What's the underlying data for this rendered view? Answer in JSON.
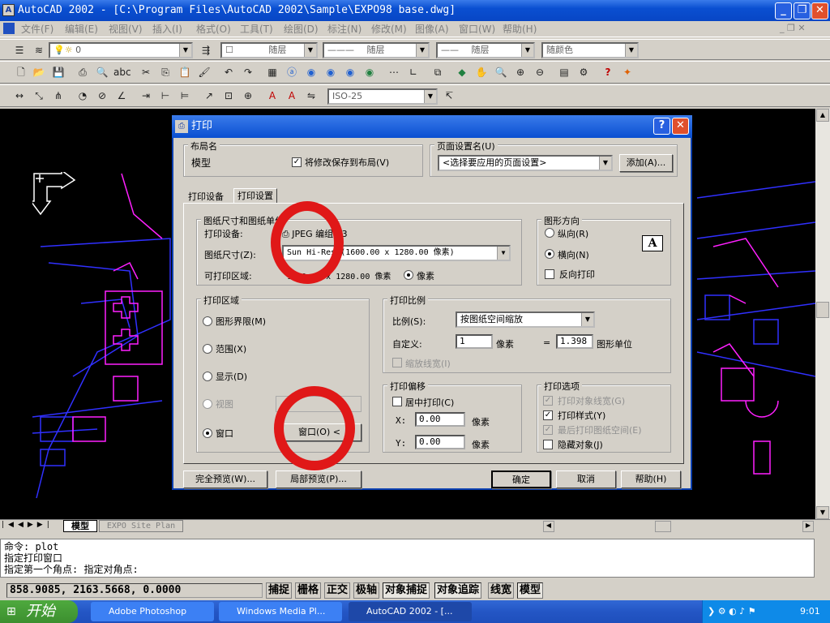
{
  "window": {
    "title": "AutoCAD 2002 - [C:\\Program Files\\AutoCAD 2002\\Sample\\EXPO98 base.dwg]",
    "min": "_",
    "max": "❐",
    "close": "✕"
  },
  "menu": [
    "文件(F)",
    "编辑(E)",
    "视图(V)",
    "插入(I)",
    "格式(O)",
    "工具(T)",
    "绘图(D)",
    "标注(N)",
    "修改(M)",
    "图像(A)",
    "窗口(W)",
    "帮助(H)"
  ],
  "toolbar": {
    "layer_value": "0",
    "color_value": "随层",
    "linetype_value": "随层",
    "lineweight_value": "随层",
    "plotstyle_value": "随颜色",
    "dimstyle_value": "ISO-25"
  },
  "tabs": {
    "model": "模型",
    "layout": "EXPO Site Plan"
  },
  "command": [
    "命令: plot",
    "指定打印窗口",
    "指定第一个角点: 指定对角点:"
  ],
  "status": {
    "coords": "858.9085, 2163.5668, 0.0000",
    "buttons": [
      "捕捉",
      "栅格",
      "正交",
      "极轴",
      "对象捕捉",
      "对象追踪",
      "线宽",
      "模型"
    ]
  },
  "taskbar": {
    "start": "开始",
    "tasks": [
      "Adobe Photoshop",
      "Windows Media Pl...",
      "AutoCAD 2002 - [..."
    ],
    "clock": "9:01"
  },
  "dialog": {
    "title": "打印",
    "help_btn": "?",
    "close_btn": "✕",
    "layout_group": "布局名",
    "layout_name": "模型",
    "save_changes": "将修改保存到布局(V)",
    "page_setup_group": "页面设置名(U)",
    "page_setup_value": "<选择要应用的页面设置>",
    "add_btn": "添加(A)...",
    "tab_device": "打印设备",
    "tab_settings": "打印设置",
    "paper_group": "图纸尺寸和图纸单位",
    "device_label": "打印设备:",
    "device_value": "JPEG 编组...3",
    "paper_size_label": "图纸尺寸(Z):",
    "paper_size_value": "Sun Hi-Res (1600.00 x 1280.00 像素)",
    "printable_label": "可打印区域:",
    "printable_value": "1600.00 x 1280.00 像素",
    "pixel_unit": "像素",
    "orient_group": "图形方向",
    "portrait": "纵向(R)",
    "landscape": "横向(N)",
    "reverse": "反向打印",
    "orient_icon": "A",
    "area_group": "打印区域",
    "limits": "图形界限(M)",
    "extents": "范围(X)",
    "display": "显示(D)",
    "view": "视图",
    "window": "窗口",
    "window_btn": "窗口(O) <",
    "scale_group": "打印比例",
    "scale_label": "比例(S):",
    "scale_value": "按图纸空间缩放",
    "custom_label": "自定义:",
    "custom_val": "1",
    "custom_unit": "像素",
    "equals": "=",
    "custom_val2": "1.398",
    "custom_unit2": "图形单位",
    "scale_lw": "缩放线宽(I)",
    "offset_group": "打印偏移",
    "center": "居中打印(C)",
    "x_label": "X:",
    "x_value": "0.00",
    "x_unit": "像素",
    "y_label": "Y:",
    "y_value": "0.00",
    "y_unit": "像素",
    "options_group": "打印选项",
    "opt_lw": "打印对象线宽(G)",
    "opt_styles": "打印样式(Y)",
    "opt_last": "最后打印图纸空间(E)",
    "opt_hide": "隐藏对象(J)",
    "full_preview": "完全预览(W)...",
    "partial_preview": "局部预览(P)...",
    "ok": "确定",
    "cancel": "取消",
    "help": "帮助(H)"
  }
}
